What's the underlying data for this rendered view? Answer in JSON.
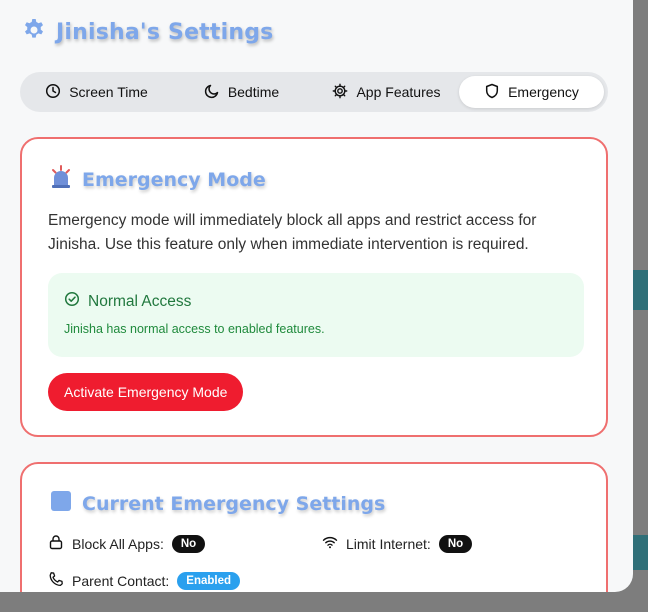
{
  "colors": {
    "accent_title": "#7ea7ea",
    "card_border": "#ef6f6f",
    "danger_button": "#ef1c2f",
    "status_bg": "#ecfbf1",
    "status_text": "#21783e",
    "badge_dark": "#111111",
    "badge_blue": "#2aa0ee"
  },
  "header": {
    "icon": "gear-icon",
    "title": "Jinisha's Settings"
  },
  "tabs": [
    {
      "icon": "clock-icon",
      "label": "Screen Time",
      "active": false
    },
    {
      "icon": "moon-icon",
      "label": "Bedtime",
      "active": false
    },
    {
      "icon": "gear-icon",
      "label": "App Features",
      "active": false
    },
    {
      "icon": "shield-icon",
      "label": "Emergency",
      "active": true
    }
  ],
  "emergency": {
    "icon": "siren-icon",
    "title": "Emergency Mode",
    "description": "Emergency mode will immediately block all apps and restrict access for Jinisha. Use this feature only when immediate intervention is required.",
    "status_title": "Normal Access",
    "status_message": "Jinisha has normal access to enabled features.",
    "button_label": "Activate Emergency Mode"
  },
  "current_settings": {
    "icon": "square-icon",
    "title": "Current Emergency Settings",
    "items": [
      {
        "icon": "lock-icon",
        "label": "Block All Apps:",
        "value": "No"
      },
      {
        "icon": "wifi-icon",
        "label": "Limit Internet:",
        "value": "No"
      },
      {
        "icon": "phone-icon",
        "label": "Parent Contact:",
        "value": "Enabled"
      }
    ]
  }
}
